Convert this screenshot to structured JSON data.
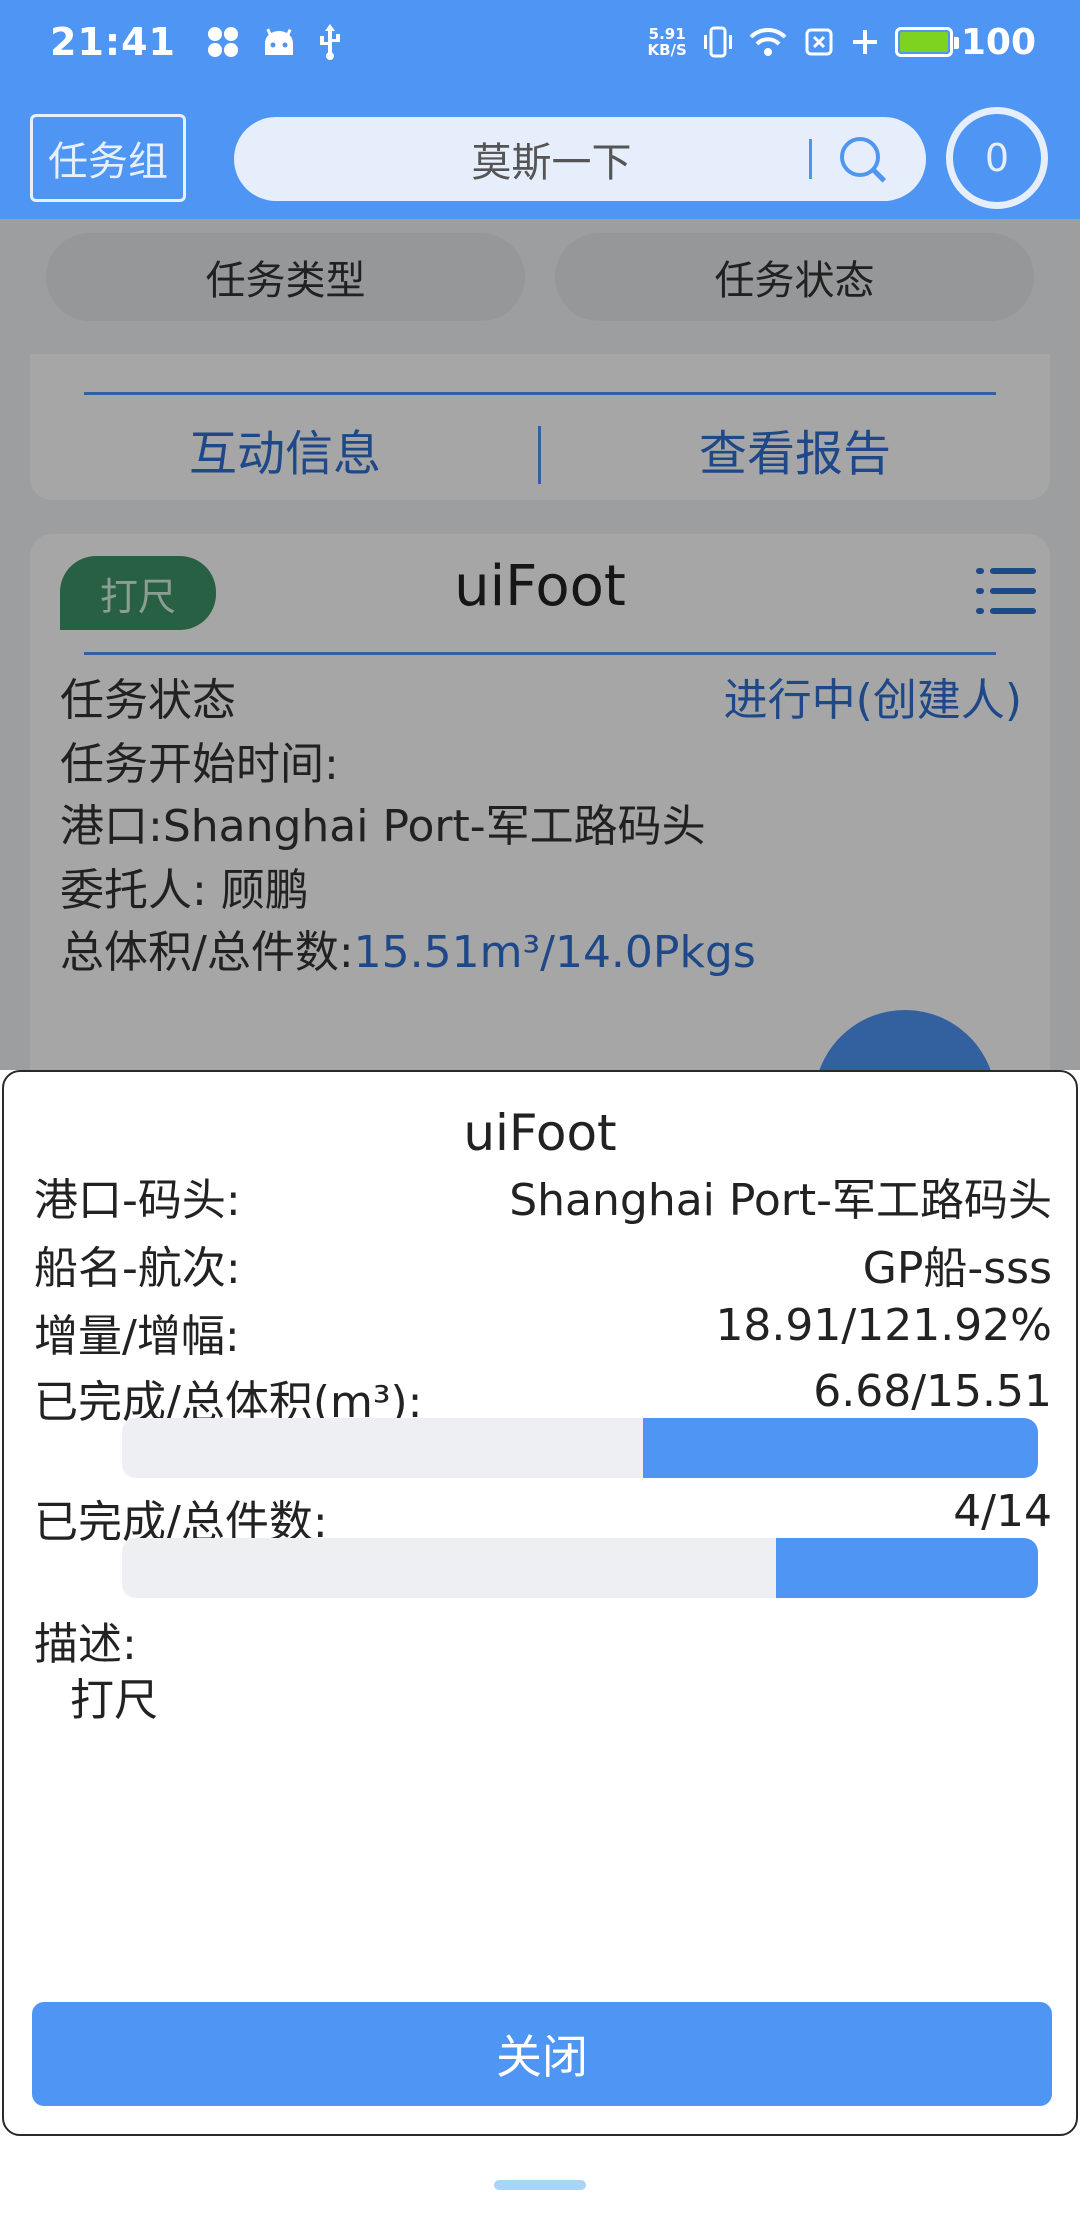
{
  "status_bar": {
    "time": "21:41",
    "net_speed_value": "5.91",
    "net_speed_unit": "KB/S",
    "battery_level": "100",
    "battery_color": "#7ed321"
  },
  "header": {
    "group_button": "任务组",
    "search_placeholder": "莫斯一下",
    "badge_count": "0"
  },
  "filters": {
    "task_type": "任务类型",
    "task_status": "任务状态"
  },
  "previous_card": {
    "action_interact": "互动信息",
    "action_report": "查看报告"
  },
  "card": {
    "tag": "打尺",
    "title": "uiFoot",
    "status_label": "任务状态",
    "status_value": "进行中(创建人)",
    "start_time_label": "任务开始时间:",
    "port_line": "港口:Shanghai Port-军工路码头",
    "client_line": "委托人: 顾鹏",
    "volume_label": "总体积/总件数:",
    "volume_value": "15.51m³/14.0Pkgs"
  },
  "sheet": {
    "title": "uiFoot",
    "rows": [
      {
        "label": "港口-码头:",
        "value": "Shanghai Port-军工路码头"
      },
      {
        "label": "船名-航次:",
        "value": "GP船-sss"
      },
      {
        "label": "增量/增幅:",
        "value": "18.91/121.92%"
      }
    ],
    "volume_progress": {
      "label": "已完成/总体积(m³):",
      "value": "6.68/15.51",
      "fraction": 0.431
    },
    "pieces_progress": {
      "label": "已完成/总件数:",
      "value": "4/14",
      "fraction": 0.286
    },
    "description_label": "描述:",
    "description_value": "打尺",
    "close_button": "关闭"
  },
  "colors": {
    "primary": "#4f95f4",
    "link": "#2e6fd1",
    "tag_green": "#3e9467"
  }
}
